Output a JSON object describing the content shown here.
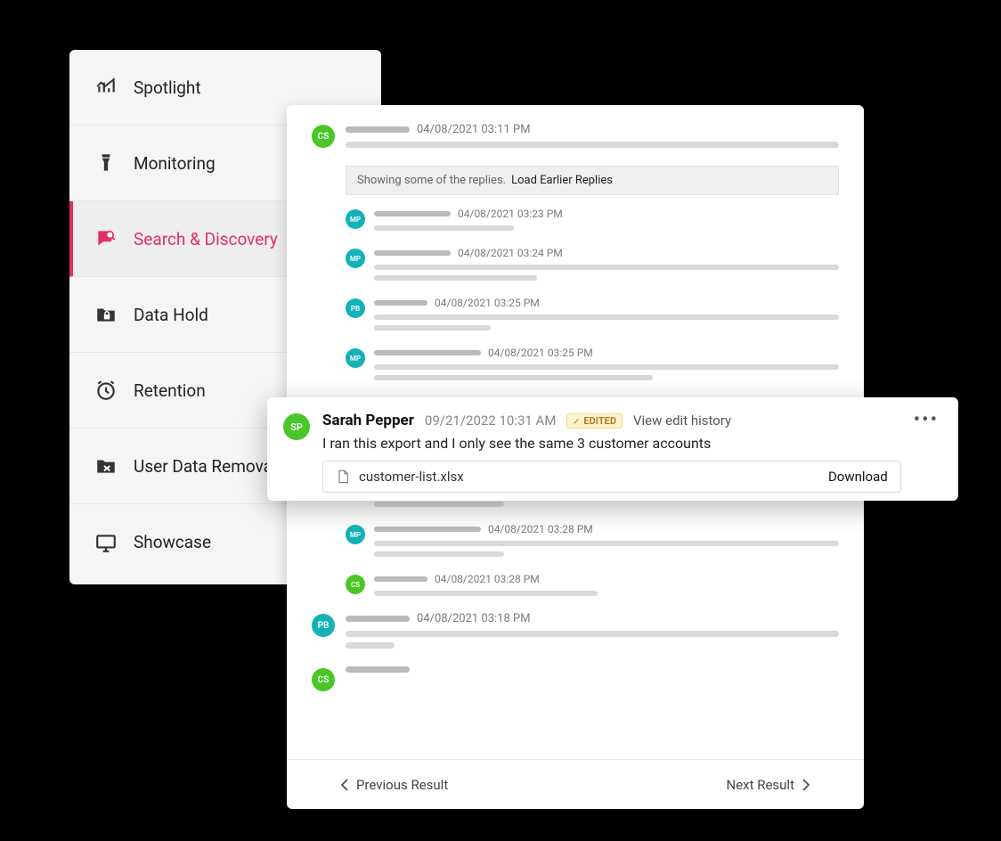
{
  "sidebar": {
    "items": [
      {
        "label": "Spotlight"
      },
      {
        "label": "Monitoring"
      },
      {
        "label": "Search & Discovery"
      },
      {
        "label": "Data Hold"
      },
      {
        "label": "Retention"
      },
      {
        "label": "User Data Removal"
      },
      {
        "label": "Showcase"
      }
    ]
  },
  "replies_banner": {
    "prefix": "Showing some of the replies.",
    "action": "Load Earlier Replies"
  },
  "messages": {
    "top": {
      "initials": "CS",
      "ts": "04/08/2021 03:11 PM"
    },
    "replies1": [
      {
        "initials": "MP",
        "ts": "04/08/2021 03:23 PM"
      },
      {
        "initials": "MP",
        "ts": "04/08/2021 03:24 PM"
      },
      {
        "initials": "PB",
        "ts": "04/08/2021 03:25 PM"
      },
      {
        "initials": "MP",
        "ts": "04/08/2021 03:25 PM"
      }
    ],
    "replies2": [
      {
        "initials": "MP",
        "ts": "04/08/2021 03:28 PM"
      },
      {
        "initials": "CS",
        "ts": "04/08/2021 03:28 PM"
      }
    ],
    "tail": [
      {
        "initials": "PB",
        "ts": "04/08/2021 03:18 PM"
      },
      {
        "initials": "CS",
        "ts": ""
      }
    ]
  },
  "pager": {
    "prev": "Previous Result",
    "next": "Next Result"
  },
  "highlight": {
    "initials": "SP",
    "name": "Sarah Pepper",
    "ts": "09/21/2022 10:31 AM",
    "edited_label": "EDITED",
    "history_link": "View edit history",
    "text": "I ran this export and I only see the same 3 customer accounts",
    "file": {
      "name": "customer-list.xlsx",
      "action": "Download"
    }
  }
}
